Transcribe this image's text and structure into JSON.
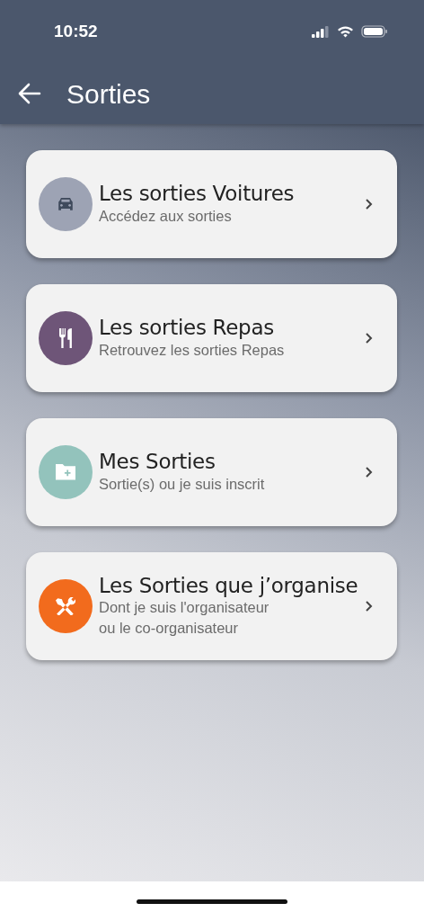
{
  "status_bar": {
    "time": "10:52"
  },
  "app_bar": {
    "title": "Sorties"
  },
  "items": [
    {
      "kind": "car",
      "color": "#9da3b4",
      "title": "Les sorties Voitures",
      "subtitle": "Accédez aux sorties"
    },
    {
      "kind": "cutlery",
      "color": "#6e5578",
      "title": "Les sorties Repas",
      "subtitle": "Retrouvez les sorties Repas"
    },
    {
      "kind": "folder",
      "color": "#93c3bc",
      "title": "Mes Sorties",
      "subtitle": "Sortie(s) ou je suis inscrit"
    },
    {
      "kind": "tools",
      "color": "#f26b1d",
      "title": "Les Sorties que j’organise",
      "subtitle": "Dont je suis l'organisateur\nou le co-organisateur"
    }
  ]
}
